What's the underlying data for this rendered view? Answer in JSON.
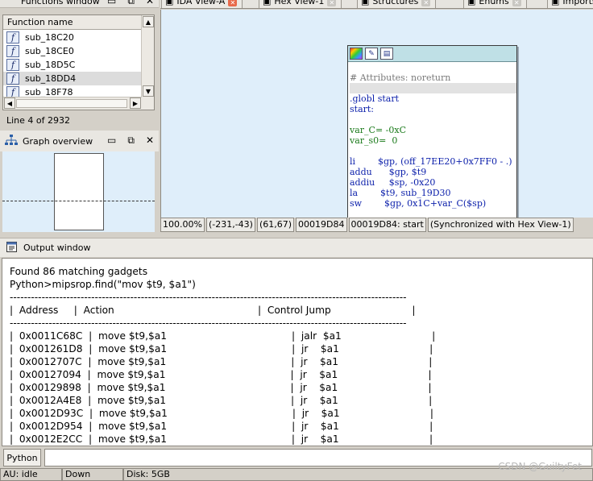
{
  "functions_window": {
    "title": "Functions window",
    "column_header": "Function name",
    "items": [
      {
        "name": "sub_18C20",
        "selected": false
      },
      {
        "name": "sub_18CE0",
        "selected": false
      },
      {
        "name": "sub_18D5C",
        "selected": false
      },
      {
        "name": "sub_18DD4",
        "selected": true
      },
      {
        "name": "sub_18F78",
        "selected": false
      }
    ],
    "line_info": "Line 4 of 2932"
  },
  "graph_overview": {
    "title": "Graph overview"
  },
  "tabs": [
    {
      "label": "IDA View-A",
      "active": true
    },
    {
      "label": "Hex View-1",
      "active": false
    },
    {
      "label": "Structures",
      "active": false
    },
    {
      "label": "Enums",
      "active": false
    },
    {
      "label": "Imports",
      "active": false
    }
  ],
  "ida_view": {
    "code_lines": [
      {
        "text": "",
        "cls": ""
      },
      {
        "text": "# Attributes: noreturn",
        "cls": "c-gray"
      },
      {
        "text": "",
        "cls": "hl-band"
      },
      {
        "text": ".globl start",
        "cls": "c-blue"
      },
      {
        "text": "start:",
        "cls": "c-blue"
      },
      {
        "text": "",
        "cls": ""
      },
      {
        "text": "var_C= -0xC",
        "cls": "c-green"
      },
      {
        "text": "var_s0=  0",
        "cls": "c-green"
      },
      {
        "text": "",
        "cls": ""
      },
      {
        "text": "li        $gp, (off_17EE20+0x7FF0 - .)",
        "cls": "c-blue"
      },
      {
        "text": "addu      $gp, $t9",
        "cls": "c-blue"
      },
      {
        "text": "addiu     $sp, -0x20",
        "cls": "c-blue"
      },
      {
        "text": "la        $t9, sub_19D30",
        "cls": "c-blue"
      },
      {
        "text": "sw        $gp, 0x1C+var_C($sp)",
        "cls": "c-blue"
      }
    ],
    "status": {
      "zoom": "100.00%",
      "coords": "(-231,-43)",
      "pos": "(61,67)",
      "offset": "00019D84",
      "location": "00019D84: start",
      "sync": "(Synchronized with Hex View-1)"
    }
  },
  "output_window": {
    "title": "Output window",
    "lines": [
      "Found 86 matching gadgets",
      "Python>mipsrop.find(\"mov $t9, $a1\")",
      "----------------------------------------------------------------------------------------------------------------",
      "|  Address     |  Action                                              |  Control Jump                          |",
      "----------------------------------------------------------------------------------------------------------------",
      "|  0x0011C68C  |  move $t9,$a1                                        |  jalr  $a1                             |",
      "|  0x001261D8  |  move $t9,$a1                                        |  jr    $a1                             |",
      "|  0x0012707C  |  move $t9,$a1                                        |  jr    $a1                             |",
      "|  0x00127094  |  move $t9,$a1                                        |  jr    $a1                             |",
      "|  0x00129898  |  move $t9,$a1                                        |  jr    $a1                             |",
      "|  0x0012A4E8  |  move $t9,$a1                                        |  jr    $a1                             |",
      "|  0x0012D93C  |  move $t9,$a1                                        |  jr    $a1                             |",
      "|  0x0012D954  |  move $t9,$a1                                        |  jr    $a1                             |",
      "|  0x0012E2CC  |  move $t9,$a1                                        |  jr    $a1                             |"
    ]
  },
  "python_bar": {
    "button_label": "Python",
    "input_value": ""
  },
  "status_bar": {
    "au": "AU:  idle",
    "state": "Down",
    "disk": "Disk: 5GB"
  },
  "watermark": "CSDN @GuiltyFet"
}
